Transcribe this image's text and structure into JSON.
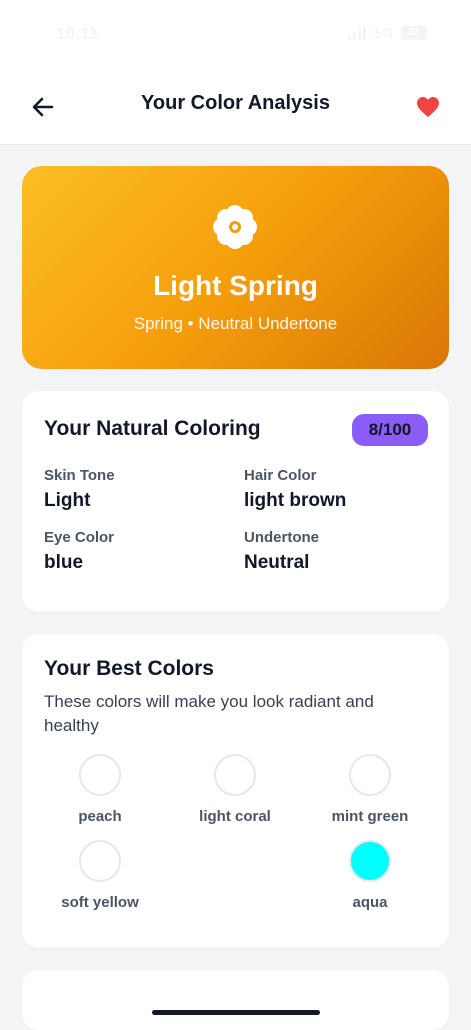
{
  "status": {
    "time": "10:11",
    "network": "5G",
    "battery": "83"
  },
  "header": {
    "title": "Your Color Analysis",
    "back_icon": "arrow-left-icon",
    "favorite_icon": "heart-icon"
  },
  "hero": {
    "icon": "flower-icon",
    "title": "Light Spring",
    "subtitle": "Spring • Neutral Undertone",
    "gradient": [
      "#fbbf24",
      "#f59e0b",
      "#d97706"
    ]
  },
  "coloring": {
    "title": "Your Natural Coloring",
    "score": "8/100",
    "attributes": [
      {
        "label": "Skin Tone",
        "value": "Light"
      },
      {
        "label": "Hair Color",
        "value": "light brown"
      },
      {
        "label": "Eye Color",
        "value": "blue"
      },
      {
        "label": "Undertone",
        "value": "Neutral"
      }
    ]
  },
  "best_colors": {
    "title": "Your Best Colors",
    "description": "These colors will make you look radiant and healthy",
    "swatches": [
      {
        "name": "peach",
        "color": "#ffffff"
      },
      {
        "name": "light coral",
        "color": "#ffffff"
      },
      {
        "name": "mint green",
        "color": "#ffffff"
      },
      {
        "name": "soft yellow",
        "color": "#ffffff"
      },
      {
        "name": "aqua",
        "color": "#00ffff"
      }
    ]
  },
  "colors": {
    "accent_purple": "#8b5cf6",
    "favorite_red": "#ef4444"
  }
}
